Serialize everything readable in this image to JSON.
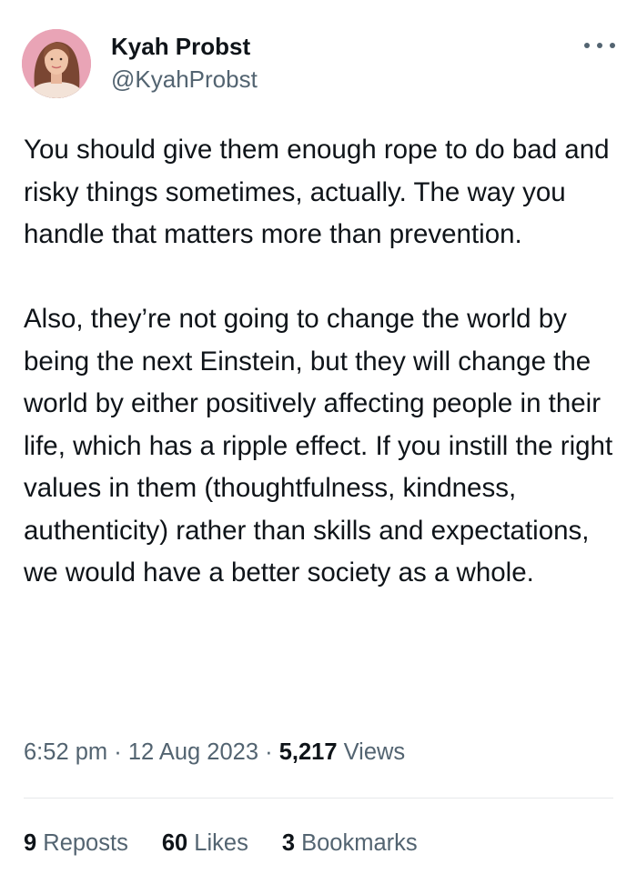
{
  "author": {
    "display_name": "Kyah Probst",
    "handle": "@KyahProbst"
  },
  "tweet": {
    "paragraph_1": "You should give them enough rope to do bad and risky things sometimes, actually. The way you handle that matters more than prevention.",
    "paragraph_2": "Also, they’re not going to change the world by being the next Einstein, but they will change the world by either positively affecting people in their life, which has a ripple effect. If you instill the right values in them (thoughtfulness, kindness, authenticity) rather than skills and expectations, we would have a better society as a whole."
  },
  "meta": {
    "time": "6:52 pm",
    "separator_1": " · ",
    "date": "12 Aug 2023",
    "separator_2": " · ",
    "views_count": "5,217",
    "views_label": " Views"
  },
  "stats": {
    "reposts_count": "9",
    "reposts_label": " Reposts",
    "likes_count": "60",
    "likes_label": " Likes",
    "bookmarks_count": "3",
    "bookmarks_label": " Bookmarks"
  },
  "icons": {
    "more": "more-horizontal-icon"
  },
  "colors": {
    "text_primary": "#0f1419",
    "text_secondary": "#536471",
    "divider": "#e7e9ea",
    "avatar_bg": "#e8a0b2"
  }
}
